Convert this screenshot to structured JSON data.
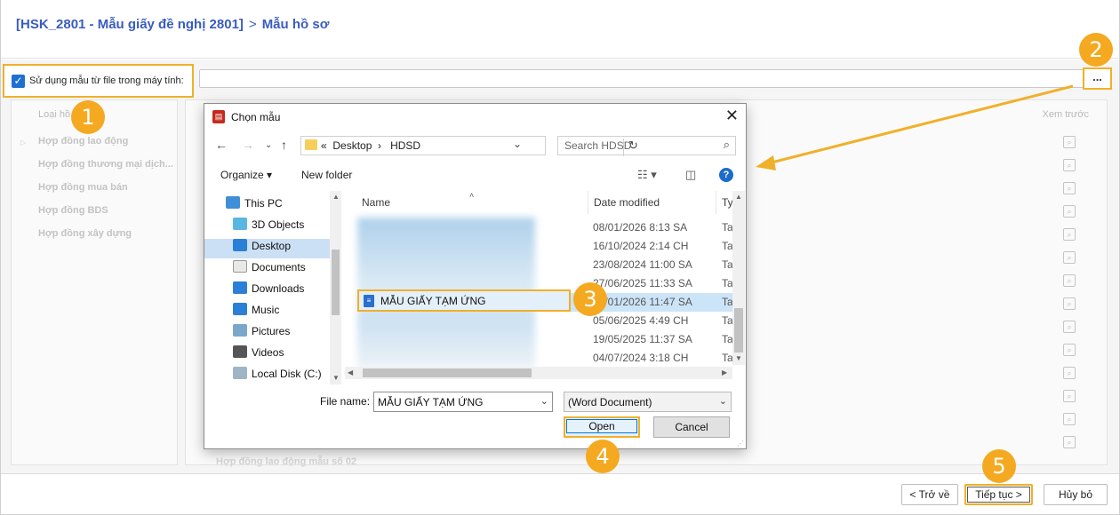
{
  "breadcrumb": {
    "parent": "[HSK_2801 - Mẫu giấy đề nghị 2801]",
    "separator": ">",
    "current": "Mẫu hồ sơ"
  },
  "options": {
    "use_local_file_label": "Sử dụng mẫu từ file trong máy tính:",
    "use_local_file_checked": true,
    "browse_label": "..."
  },
  "left_list": {
    "header": "Loại hồ",
    "items": [
      "Hợp đồng lao động",
      "Hợp đồng thương mại dịch...",
      "Hợp đồng mua bán",
      "Hợp đồng BDS",
      "Hợp đồng xây dựng"
    ]
  },
  "right_list": {
    "preview_header": "Xem trước",
    "hidden_row_text": "Hợp đồng lao động mẫu số 02"
  },
  "footer": {
    "back_label": "< Trở về",
    "next_label": "Tiếp tục >",
    "cancel_label": "Hủy bỏ"
  },
  "badges": [
    "1",
    "2",
    "3",
    "4",
    "5"
  ],
  "dialog": {
    "title": "Chọn mẫu",
    "close_label": "✕",
    "address": {
      "prefix": "«",
      "crumbs": [
        "Desktop",
        "HDSD"
      ]
    },
    "search_placeholder": "Search HDSD",
    "toolbar": {
      "organize": "Organize",
      "new_folder": "New folder"
    },
    "nav_tree": [
      {
        "label": "This PC",
        "icon": "pc-icon"
      },
      {
        "label": "3D Objects",
        "icon": "cube-icon"
      },
      {
        "label": "Desktop",
        "icon": "desktop-icon",
        "selected": true
      },
      {
        "label": "Documents",
        "icon": "document-icon"
      },
      {
        "label": "Downloads",
        "icon": "download-icon"
      },
      {
        "label": "Music",
        "icon": "music-icon"
      },
      {
        "label": "Pictures",
        "icon": "picture-icon"
      },
      {
        "label": "Videos",
        "icon": "video-icon"
      },
      {
        "label": "Local Disk (C:)",
        "icon": "disk-icon"
      }
    ],
    "columns": {
      "name": "Name",
      "date": "Date modified",
      "type": "Ty"
    },
    "rows": [
      {
        "date": "08/01/2026 8:13 SA",
        "type": "Ta"
      },
      {
        "date": "16/10/2024 2:14 CH",
        "type": "Ta"
      },
      {
        "date": "23/08/2024 11:00 SA",
        "type": "Ta"
      },
      {
        "date": "27/06/2025 11:33 SA",
        "type": "Ta"
      },
      {
        "date": "08/01/2026 11:47 SA",
        "type": "Ta",
        "selected": true
      },
      {
        "date": "05/06/2025 4:49 CH",
        "type": "Ta"
      },
      {
        "date": "19/05/2025 11:37 SA",
        "type": "Ta"
      },
      {
        "date": "04/07/2024 3:18 CH",
        "type": "Ta"
      }
    ],
    "selected_file": "MẪU GIẤY TẠM ỨNG",
    "file_name_label": "File name:",
    "file_name_value": "MẪU GIẤY TẠM ỨNG",
    "file_type_value": "(Word Document)",
    "open_label": "Open",
    "cancel_label": "Cancel"
  },
  "colors": {
    "accent_blue": "#3a5cc0",
    "highlight": "#f0b02a",
    "badge": "#f4a920",
    "selection": "#cce4f7"
  }
}
